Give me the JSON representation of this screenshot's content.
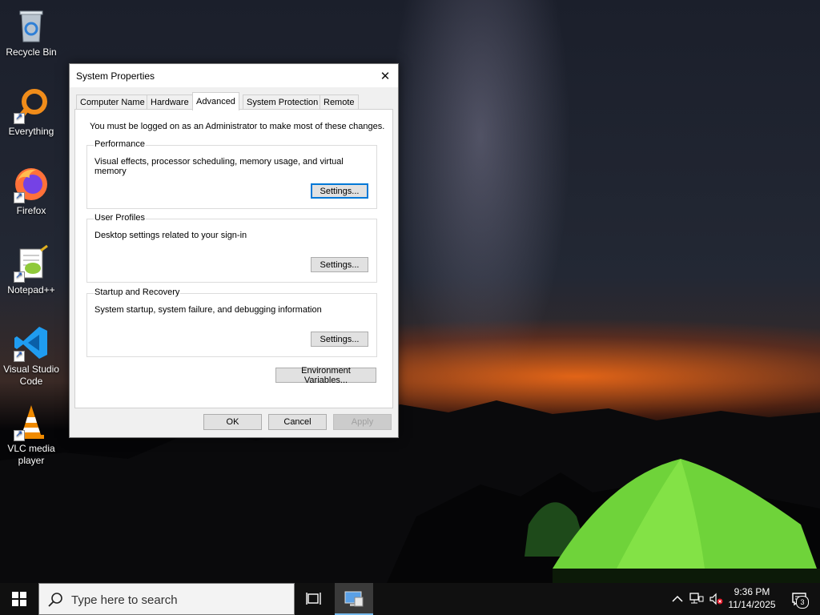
{
  "desktop": {
    "icons": [
      {
        "label": "Recycle Bin"
      },
      {
        "label": "Everything"
      },
      {
        "label": "Firefox"
      },
      {
        "label": "Notepad++"
      },
      {
        "label": "Visual Studio Code"
      },
      {
        "label": "VLC media player"
      }
    ]
  },
  "dialog": {
    "title": "System Properties",
    "tabs": [
      {
        "label": "Computer Name",
        "active": false
      },
      {
        "label": "Hardware",
        "active": false
      },
      {
        "label": "Advanced",
        "active": true
      },
      {
        "label": "System Protection",
        "active": false
      },
      {
        "label": "Remote",
        "active": false
      }
    ],
    "admin_note": "You must be logged on as an Administrator to make most of these changes.",
    "groups": [
      {
        "title": "Performance",
        "description": "Visual effects, processor scheduling, memory usage, and virtual memory",
        "button": "Settings..."
      },
      {
        "title": "User Profiles",
        "description": "Desktop settings related to your sign-in",
        "button": "Settings..."
      },
      {
        "title": "Startup and Recovery",
        "description": "System startup, system failure, and debugging information",
        "button": "Settings..."
      }
    ],
    "env_button": "Environment Variables...",
    "ok_button": "OK",
    "cancel_button": "Cancel",
    "apply_button": "Apply"
  },
  "taskbar": {
    "search_placeholder": "Type here to search",
    "time": "9:36 PM",
    "date": "11/14/2025",
    "notification_count": "3"
  },
  "colors": {
    "accent": "#0078d7",
    "taskbar": "#101010",
    "tent": "#6fd33a"
  }
}
